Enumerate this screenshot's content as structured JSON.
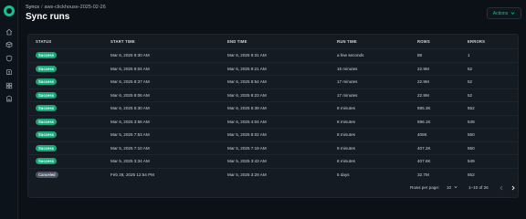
{
  "breadcrumb": {
    "parent": "Syncs",
    "separator": "/",
    "current": "aws-clickhouse-2025-02-26"
  },
  "page_title": "Sync runs",
  "actions_label": "Actions",
  "columns": [
    "STATUS",
    "START TIME",
    "END TIME",
    "RUN TIME",
    "ROWS",
    "ERRORS"
  ],
  "rows": [
    {
      "status": "Success",
      "status_kind": "success",
      "start": "Mar 6, 2025 9:30 AM",
      "end": "Mar 6, 2025 9:31 AM",
      "run": "a few seconds",
      "rows": "88",
      "errors": "1"
    },
    {
      "status": "Success",
      "status_kind": "success",
      "start": "Mar 6, 2025 9:04 AM",
      "end": "Mar 6, 2025 9:21 AM",
      "run": "16 minutes",
      "rows": "22.9M",
      "errors": "52"
    },
    {
      "status": "Success",
      "status_kind": "success",
      "start": "Mar 6, 2025 8:37 AM",
      "end": "Mar 6, 2025 8:54 AM",
      "run": "17 minutes",
      "rows": "22.9M",
      "errors": "52"
    },
    {
      "status": "Success",
      "status_kind": "success",
      "start": "Mar 6, 2025 8:06 AM",
      "end": "Mar 6, 2025 8:23 AM",
      "run": "17 minutes",
      "rows": "22.9M",
      "errors": "52"
    },
    {
      "status": "Success",
      "status_kind": "success",
      "start": "Mar 6, 2025 5:30 AM",
      "end": "Mar 6, 2025 5:39 AM",
      "run": "8 minutes",
      "rows": "595.3K",
      "errors": "552"
    },
    {
      "status": "Success",
      "status_kind": "success",
      "start": "Mar 6, 2025 3:56 AM",
      "end": "Mar 6, 2025 4:04 AM",
      "run": "8 minutes",
      "rows": "596.1K",
      "errors": "549"
    },
    {
      "status": "Success",
      "status_kind": "success",
      "start": "Mar 5, 2025 7:53 AM",
      "end": "Mar 5, 2025 8:02 AM",
      "run": "8 minutes",
      "rows": "408K",
      "errors": "550"
    },
    {
      "status": "Success",
      "status_kind": "success",
      "start": "Mar 5, 2025 7:10 AM",
      "end": "Mar 5, 2025 7:19 AM",
      "run": "9 minutes",
      "rows": "407.2K",
      "errors": "550"
    },
    {
      "status": "Success",
      "status_kind": "success",
      "start": "Mar 5, 2025 3:34 AM",
      "end": "Mar 5, 2025 3:43 AM",
      "run": "8 minutes",
      "rows": "407.6K",
      "errors": "549"
    },
    {
      "status": "Canceled",
      "status_kind": "canceled",
      "start": "Feb 28, 2025 12:54 PM",
      "end": "Mar 5, 2025 3:29 AM",
      "run": "5 days",
      "rows": "32.7M",
      "errors": "552"
    }
  ],
  "pagination": {
    "rows_per_page_label": "Rows per page:",
    "rows_per_page_value": "10",
    "range_text": "1–10 of 26"
  },
  "colors": {
    "accent": "#17c08d",
    "success_badge": "#17a57a",
    "canceled_badge": "#4a5360",
    "background": "#0c1118",
    "card": "#141b23"
  },
  "rail_icons": [
    "home-icon",
    "box-icon",
    "shield-icon",
    "book-icon",
    "grid-icon",
    "building-icon"
  ]
}
